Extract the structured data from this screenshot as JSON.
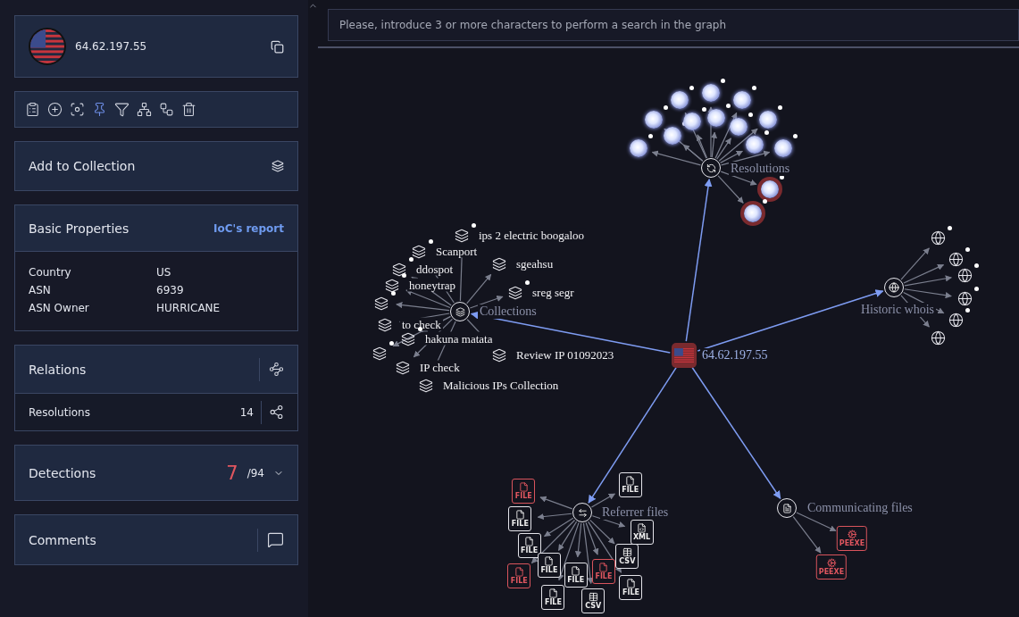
{
  "search": {
    "placeholder": "Please, introduce 3 or more characters to perform a search in the graph"
  },
  "entity": {
    "ip": "64.62.197.55"
  },
  "toolbar": [
    {
      "kind": "report",
      "active": false
    },
    {
      "kind": "add",
      "active": false
    },
    {
      "kind": "focus",
      "active": false
    },
    {
      "kind": "pin",
      "active": true
    },
    {
      "kind": "filter",
      "active": false
    },
    {
      "kind": "hierarchy",
      "active": false
    },
    {
      "kind": "tree",
      "active": false
    },
    {
      "kind": "delete",
      "active": false
    }
  ],
  "collection": {
    "label": "Add to Collection"
  },
  "properties": {
    "title": "Basic Properties",
    "link": "IoC's report",
    "rows": [
      {
        "key": "Country",
        "value": "US"
      },
      {
        "key": "ASN",
        "value": "6939"
      },
      {
        "key": "ASN Owner",
        "value": "HURRICANE"
      }
    ]
  },
  "relations": {
    "title": "Relations",
    "items": [
      {
        "label": "Resolutions",
        "count": "14"
      }
    ]
  },
  "detections": {
    "title": "Detections",
    "malicious": "7",
    "total": "/94"
  },
  "comments": {
    "title": "Comments"
  },
  "graph": {
    "center": {
      "label": "64.62.197.55"
    },
    "groups": [
      {
        "kind": "resolutions",
        "label": "Resolutions",
        "nodes": [
          {
            "flagged": false
          },
          {
            "flagged": false
          },
          {
            "flagged": false
          },
          {
            "flagged": false
          },
          {
            "flagged": false
          },
          {
            "flagged": false
          },
          {
            "flagged": false
          },
          {
            "flagged": false
          },
          {
            "flagged": false
          },
          {
            "flagged": false
          },
          {
            "flagged": false
          },
          {
            "flagged": false
          },
          {
            "flagged": true
          },
          {
            "flagged": true
          }
        ]
      },
      {
        "kind": "whois",
        "label": "Historic whois",
        "nodes": [
          {
            "dot": true
          },
          {
            "dot": true
          },
          {
            "dot": true
          },
          {
            "dot": true
          },
          {
            "dot": true
          },
          {
            "dot": false
          }
        ]
      },
      {
        "kind": "collections",
        "label": "Collections",
        "nodes": [
          {
            "label": "ips 2 electric boogaloo",
            "dot": true
          },
          {
            "label": "Scanport",
            "dot": true
          },
          {
            "label": "sgeahsu",
            "dot": false
          },
          {
            "label": "ddospot",
            "dot": true
          },
          {
            "label": "honeytrap",
            "dot": true
          },
          {
            "label": "sreg segr",
            "dot": true
          },
          {
            "dot": true
          },
          {
            "label": "to check",
            "dot": false
          },
          {
            "label": "hakuna matata",
            "dot": true
          },
          {
            "dot": true
          },
          {
            "label": "IP check",
            "dot": false
          },
          {
            "label": "Review IP 01092023",
            "dot": false
          },
          {
            "label": "Malicious IPs Collection",
            "dot": false
          }
        ]
      },
      {
        "kind": "referrer",
        "label": "Referrer files",
        "nodes": [
          {
            "kind": "file",
            "badge": "FILE",
            "flagged": false
          },
          {
            "kind": "file",
            "badge": "FILE",
            "flagged": true
          },
          {
            "kind": "file",
            "badge": "FILE",
            "flagged": false
          },
          {
            "kind": "file",
            "badge": "FILE",
            "flagged": false
          },
          {
            "kind": "file",
            "badge": "FILE",
            "flagged": false
          },
          {
            "kind": "file",
            "badge": "FILE",
            "flagged": false
          },
          {
            "kind": "file",
            "badge": "FILE",
            "flagged": true
          },
          {
            "kind": "table",
            "badge": "CSV",
            "flagged": false
          },
          {
            "kind": "code",
            "badge": "XML",
            "flagged": false
          },
          {
            "kind": "file",
            "badge": "FILE",
            "flagged": true
          },
          {
            "kind": "file",
            "badge": "FILE",
            "flagged": false
          },
          {
            "kind": "table",
            "badge": "CSV",
            "flagged": false
          },
          {
            "kind": "file",
            "badge": "FILE",
            "flagged": false
          }
        ]
      },
      {
        "kind": "communicating",
        "label": "Communicating files",
        "nodes": [
          {
            "kind": "exe",
            "badge": "PEEXE",
            "flagged": true
          },
          {
            "kind": "exe",
            "badge": "PEEXE",
            "flagged": true
          }
        ]
      }
    ]
  }
}
